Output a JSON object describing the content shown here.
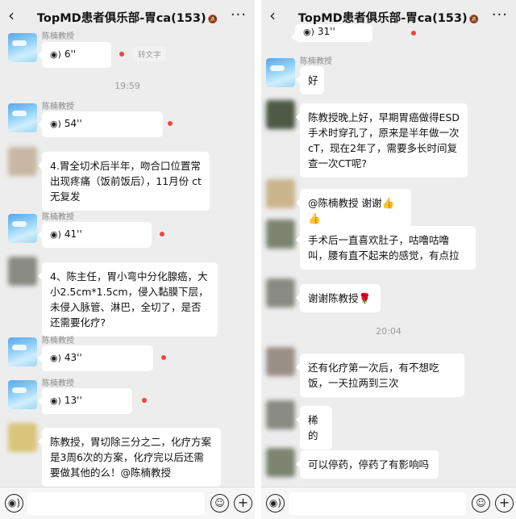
{
  "header": {
    "back_icon": "‹",
    "title": "TopMD患者俱乐部-胃ca(153)",
    "more_icon": "···"
  },
  "left": {
    "name_teacher": "陈楠教授",
    "voice1": "6''",
    "convert": "转文字",
    "time1": "19:59",
    "voice2": "54''",
    "msg1": "4.胃全切术后半年，吻合口位置常出现疼痛（饭前饭后），11月份 ct无复发",
    "voice3": "41''",
    "msg2": "4、陈主任，胃小弯中分化腺癌，大小2.5cm*1.5cm，侵入黏膜下层，未侵入脉管、淋巴，全切了，是否还需要化疗?",
    "voice4": "43''",
    "voice5": "13''",
    "msg3": "陈教授，胃切除三分之二，化疗方案是3周6次的方案，化疗完以后还需要做其他的么！@陈楠教授"
  },
  "right": {
    "name_teacher": "陈楠教授",
    "voice0": "31''",
    "reply1": "好",
    "msg1": "陈教授晚上好，早期胃癌做得ESD手术时穿孔了，原来是半年做一次cT，现在2年了，需要多长时间复查一次CT呢?",
    "msg2": "@陈楠教授 谢谢",
    "msg2_emoji": "👍👍",
    "msg3": "手术后一直喜欢肚子，咕噜咕噜叫，腰有直不起来的感觉，有点拉",
    "msg4": "谢谢陈教授",
    "msg4_emoji": "🌹",
    "time1": "20:04",
    "msg5": "还有化疗第一次后，有不想吃饭，一天拉两到三次",
    "msg6": "稀的",
    "msg7": "可以停药，停药了有影响吗"
  },
  "inputbar": {
    "voice_icon": "◉)",
    "emoji_icon": "☺",
    "plus_icon": "+"
  },
  "colors": {
    "background": "#ededed",
    "bubble": "#ffffff",
    "unread_dot": "#f2433c",
    "avatar_blue": "#5aa7e8"
  }
}
